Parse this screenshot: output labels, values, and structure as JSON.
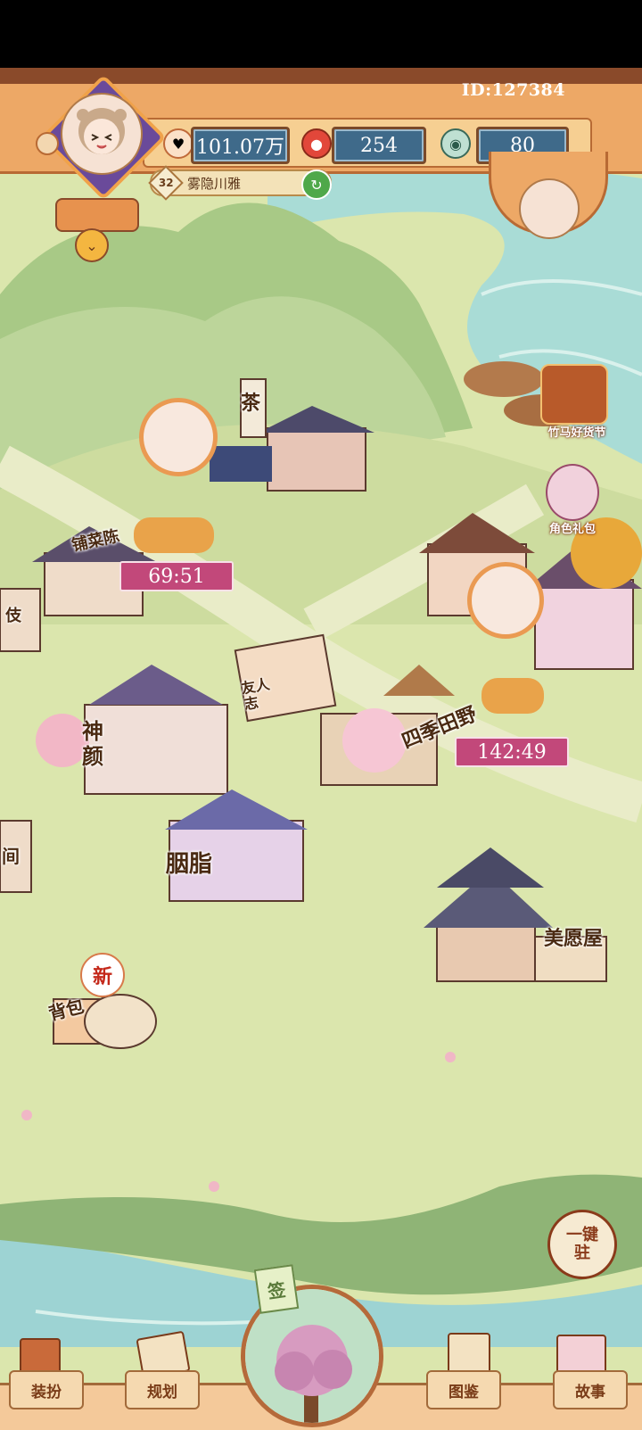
{
  "player": {
    "id_text": "ID:127384",
    "level": "32",
    "name": "雾隐川雅"
  },
  "resources": {
    "gold": "101.07万",
    "peach": "254",
    "jade": "80"
  },
  "events": {
    "festival": "竹马好货节",
    "role_pack": "角色礼包"
  },
  "timers": {
    "left_cart": "69:51",
    "right_cart": "142:49"
  },
  "buildings": {
    "shop": "铺菜陈",
    "tea_sign": "茶",
    "shenyan": "神颜",
    "yanzhi": "胭脂",
    "sijitianye": "四季田野",
    "meiyuanwu": "美愿屋",
    "youzhi": "友人志",
    "bag": "背包",
    "bag_badge": "新",
    "left_edge": "间",
    "left_edge2": "伎",
    "yijian": "一键",
    "yijian2": "驻"
  },
  "nav": {
    "zhuangban": "装扮",
    "guihua": "规划",
    "center": "签",
    "tujian": "图鉴",
    "gushi": "故事"
  },
  "colors": {
    "grass": "#d7e3a7",
    "water": "#a9dcd6",
    "mountain": "#9cbf7a",
    "topbar": "#e79a5a",
    "timer_bg": "#c2487a"
  }
}
